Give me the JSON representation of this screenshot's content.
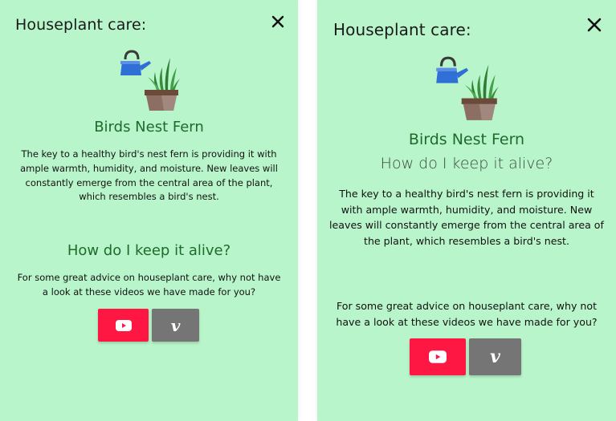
{
  "colors": {
    "background": "#b9f5ca",
    "heading_green": "#1e6b2c",
    "youtube_red": "#ff1744",
    "vimeo_grey": "#757575"
  },
  "panel_a": {
    "title": "Houseplant care:",
    "close_icon": "close-icon",
    "plant_name": "Birds Nest Fern",
    "description": "The key to a healthy bird's nest fern is providing it with ample warmth, humidity, and moisture. New leaves will constantly emerge from the central area of the plant, which resembles a bird's nest.",
    "keep_alive_heading": "How do I keep it alive?",
    "advice": "For some great advice on houseplant care, why not have a look at these videos we have made for you?",
    "buttons": [
      {
        "icon": "youtube-icon"
      },
      {
        "icon": "vimeo-icon",
        "glyph": "v"
      }
    ]
  },
  "panel_b": {
    "title": "Houseplant care:",
    "close_icon": "close-icon",
    "plant_name": "Birds Nest Fern",
    "keep_alive_heading": "How do I keep it alive?",
    "description": "The key to a healthy bird's nest fern is providing it with ample warmth, humidity, and moisture. New leaves will constantly emerge from the central area of the plant, which resembles a bird's nest.",
    "advice": "For some great advice on houseplant care, why not have a look at these videos we have made for you?",
    "buttons": [
      {
        "icon": "youtube-icon"
      },
      {
        "icon": "vimeo-icon",
        "glyph": "v"
      }
    ]
  }
}
